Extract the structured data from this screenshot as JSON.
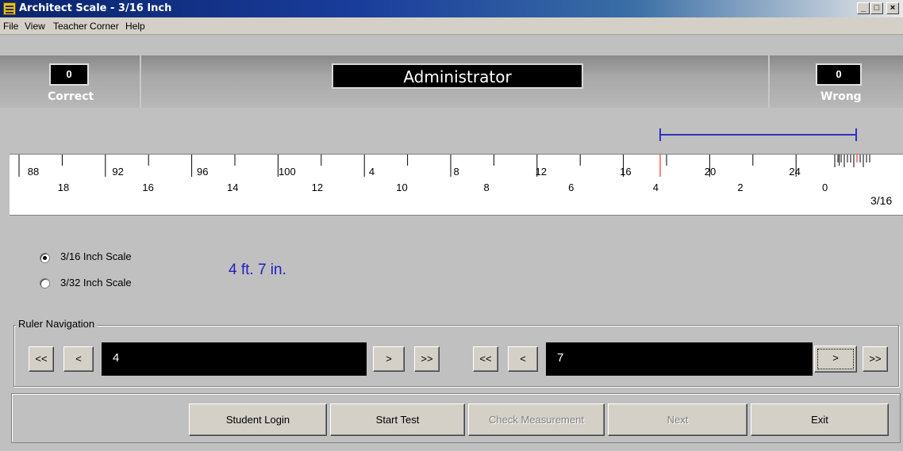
{
  "window": {
    "title": "Architect Scale - 3/16 Inch",
    "controls": {
      "minimize": "_",
      "maximize": "□",
      "close": "×"
    }
  },
  "menu": [
    "File",
    "View",
    "Teacher Corner",
    "Help"
  ],
  "header": {
    "correct_count": "0",
    "correct_label": "Correct",
    "user": "Administrator",
    "wrong_count": "0",
    "wrong_label": "Wrong"
  },
  "ruler": {
    "top_numbers": [
      "88",
      "92",
      "96",
      "100",
      "4",
      "8",
      "12",
      "16",
      "20",
      "24"
    ],
    "bottom_numbers": [
      "18",
      "16",
      "14",
      "12",
      "10",
      "8",
      "6",
      "4",
      "2",
      "0"
    ],
    "scale_label": "3/16",
    "accent_color": "#ff0000",
    "measure_line_color": "#3030c0"
  },
  "scales": {
    "options": [
      "3/16  Inch Scale",
      "3/32  Inch Scale"
    ],
    "selected": "3/16  Inch Scale"
  },
  "measurement": "4 ft. 7 in.",
  "navigation": {
    "group_label": "Ruler Navigation",
    "feet": {
      "value": "4",
      "first": "<<",
      "prev": "<",
      "next": ">",
      "last": ">>"
    },
    "inches": {
      "value": "7",
      "first": "<<",
      "prev": "<",
      "next": ">",
      "last": ">>"
    }
  },
  "buttons": {
    "student_login": "Student Login",
    "start_test": "Start Test",
    "check_measurement": "Check Measurement",
    "next": "Next",
    "exit": "Exit"
  }
}
